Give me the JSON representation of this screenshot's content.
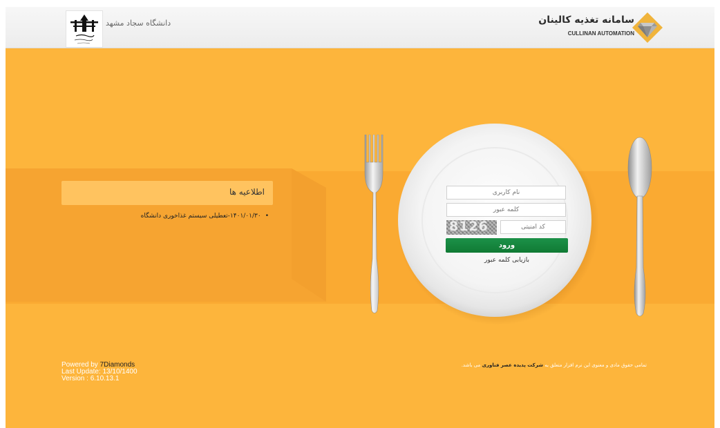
{
  "header": {
    "brand_title": "سامانه تغذیه کالینان",
    "brand_subtitle": "CULLINAN AUTOMATION",
    "university_name": "دانشگاه سجاد مشهد"
  },
  "notices": {
    "title": "اطلاعیه ها",
    "items": [
      "۱۴۰۱/۰۱/۳۰-تعطیلی سیستم غذاخوری دانشگاه"
    ]
  },
  "login": {
    "username_placeholder": "نام کاربری",
    "password_placeholder": "کلمه عبور",
    "captcha_placeholder": "کد امنیتی",
    "captcha_code": "8126",
    "submit_label": "ورود",
    "forgot_label": "بازیابی کلمه عبور"
  },
  "footer": {
    "powered_prefix": "Powered by ",
    "powered_company": "7Diamonds",
    "last_update": "Last Update: 13/10/1400",
    "version": "Version : 6.10.13.1",
    "copyright_prefix": "تمامی حقوق مادی و معنوی این نرم افزار متعلق به ",
    "copyright_company": "شرکت پدیده عصر فناوری",
    "copyright_suffix": " می باشد."
  },
  "colors": {
    "background": "#fdb53c",
    "band": "#faaa32",
    "notice_box": "#ffc35f",
    "login_button": "#158a3f"
  },
  "icons": {
    "brand_logo": "diamond-icon",
    "plate": "plate-graphic",
    "fork": "fork-graphic",
    "spoon": "spoon-graphic"
  }
}
